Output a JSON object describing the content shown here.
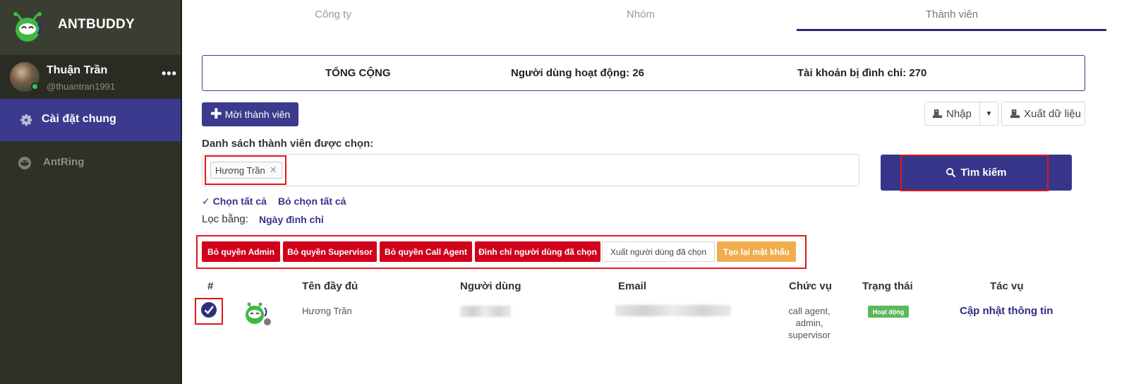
{
  "sidebar": {
    "brand": "ANTBUDDY",
    "user": {
      "name": "Thuận Trần",
      "handle": "@thuantran1991",
      "menu": "•••"
    },
    "nav": [
      {
        "label": "Cài đặt chung",
        "icon": "gear-icon",
        "active": true
      },
      {
        "label": "AntRing",
        "icon": "antring-icon",
        "active": false
      }
    ]
  },
  "tabs": [
    {
      "label": "Công ty"
    },
    {
      "label": "Nhóm"
    },
    {
      "label": "Thành viên",
      "active": true
    }
  ],
  "summary": {
    "total": "TỔNG CỘNG",
    "active_users": "Người dùng hoạt động: 26",
    "suspended": "Tài khoản bị đình chỉ: 270"
  },
  "toolbar": {
    "invite": "Mời thành viên",
    "import": "Nhập",
    "export": "Xuất dữ liệu"
  },
  "selection": {
    "label": "Danh sách thành viên được chọn:",
    "chips": [
      "Hương Trần"
    ],
    "search_button": "Tìm kiếm",
    "select_all": "✓ Chọn tất cả",
    "deselect_all": "Bỏ chọn tất cả",
    "filter_label": "Lọc bằng:",
    "filter_value": "Ngày đình chỉ"
  },
  "actions": [
    "Bỏ quyền Admin",
    "Bỏ quyền Supervisor",
    "Bỏ quyền Call Agent",
    "Đình chỉ người dùng đã chọn",
    "Xuất người dùng đã chọn",
    "Tạo lại mật khẩu"
  ],
  "table": {
    "headers": [
      "#",
      "Tên đầy đủ",
      "Người dùng",
      "Email",
      "Chức vụ",
      "Trạng thái",
      "Tác vụ"
    ],
    "rows": [
      {
        "full_name": "Hương Trần",
        "roles": [
          "call agent,",
          "admin,",
          "supervisor"
        ],
        "status": "Hoạt động",
        "action": "Cập nhật thông tin",
        "checked": true
      }
    ]
  },
  "colors": {
    "accent": "#3b3a8d",
    "sidebar": "#2e3128",
    "danger": "#d0021b",
    "warning": "#f0ad4e",
    "success": "#5cb85c",
    "highlight": "#e01818"
  }
}
